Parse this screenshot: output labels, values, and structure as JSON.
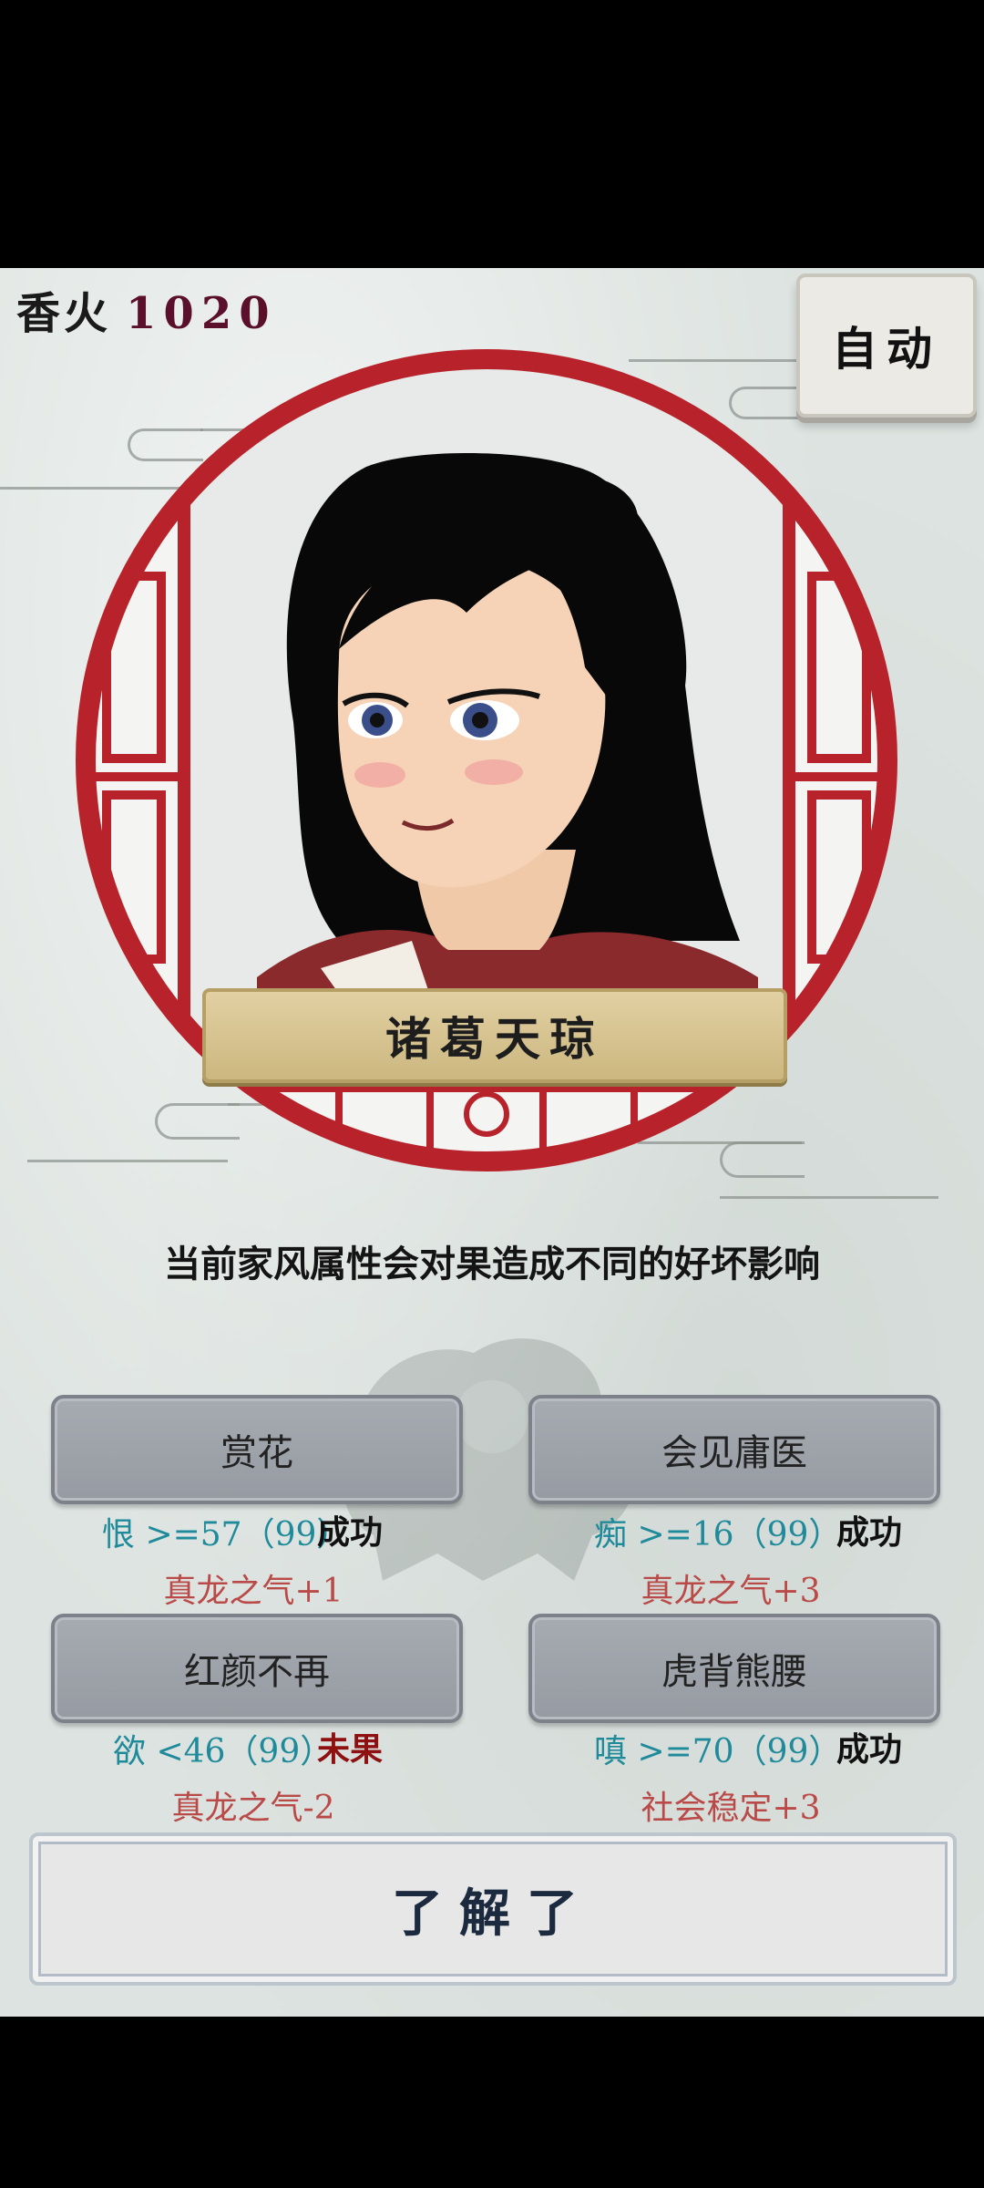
{
  "header": {
    "incense_label": "香火",
    "incense_value": "1020"
  },
  "auto_button": {
    "label": "自动"
  },
  "character": {
    "name": "诸葛天琼"
  },
  "description": "当前家风属性会对果造成不同的好坏影响",
  "options": [
    {
      "label": "赏花",
      "condition": "恨 >=57（99）",
      "status": "成功",
      "effect": "真龙之气+1"
    },
    {
      "label": "会见庸医",
      "condition": "痴 >=16（99）",
      "status": "成功",
      "effect": "真龙之气+3"
    },
    {
      "label": "红颜不再",
      "condition": "欲 <46（99）",
      "status": "未果",
      "effect": "真龙之气-2"
    },
    {
      "label": "虎背熊腰",
      "condition": "嗔 >=70（99）",
      "status": "成功",
      "effect": "社会稳定+3"
    }
  ],
  "confirm_button": {
    "label": "了解了"
  },
  "colors": {
    "frame_red": "#b8232b",
    "incense_value": "#5a0f2a",
    "condition_teal": "#1f8a9a",
    "effect_red": "#b94a48",
    "fail_red": "#8e1010"
  }
}
